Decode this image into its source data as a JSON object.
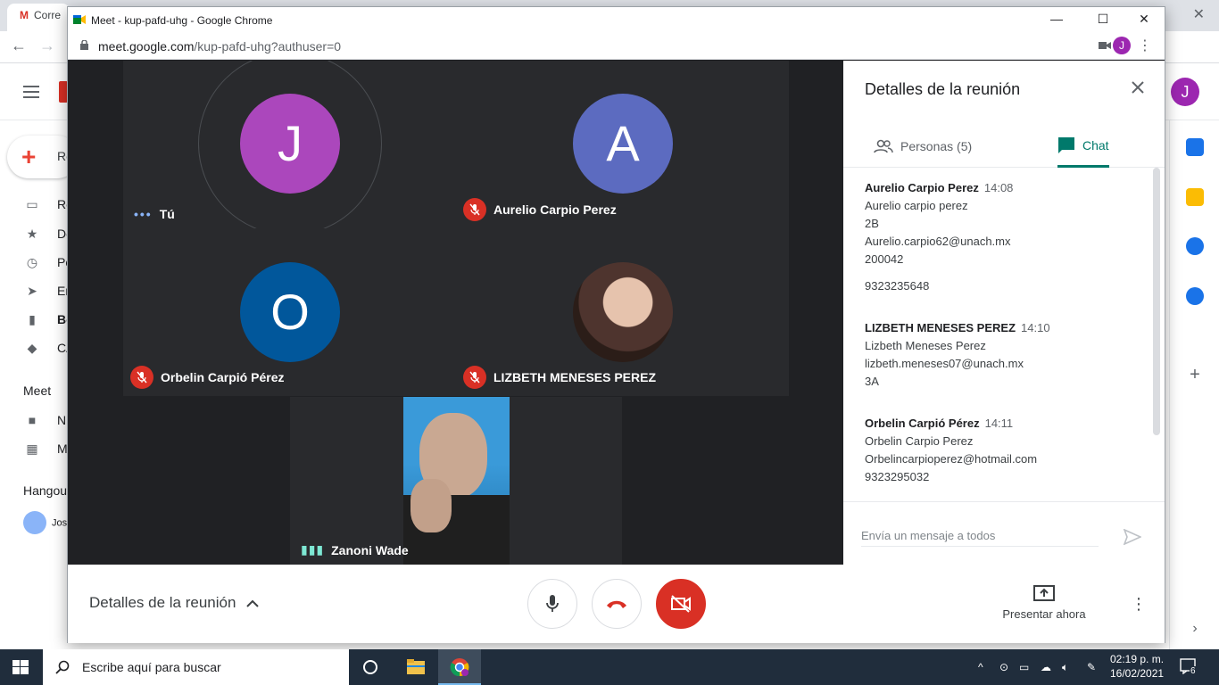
{
  "background": {
    "tab_label": "Corre",
    "compose_label": "Re",
    "nav_items": [
      "Re",
      "De",
      "Po",
      "En",
      "Bo",
      "CA"
    ],
    "meet_section": "Meet",
    "meet_items": [
      "N",
      "M"
    ],
    "hangouts_section": "Hangou",
    "hangouts_contact": "Jos",
    "avatar_letter": "J"
  },
  "window": {
    "title": "Meet - kup-pafd-uhg - Google Chrome",
    "url_host": "meet.google.com",
    "url_path": "/kup-pafd-uhg?authuser=0",
    "profile_letter": "J"
  },
  "participants": [
    {
      "initial": "J",
      "name": "Tú",
      "color": "#ab47bc",
      "muted": false
    },
    {
      "initial": "A",
      "name": "Aurelio Carpio Perez",
      "color": "#5c6bc0",
      "muted": true
    },
    {
      "initial": "O",
      "name": "Orbelin Carpió Pérez",
      "color": "#01579b",
      "muted": true
    },
    {
      "initial": "",
      "name": "LIZBETH MENESES PEREZ",
      "color": "#8d6e63",
      "muted": true
    },
    {
      "initial": "",
      "name": "Zanoni Wade",
      "color": "#1e88e5",
      "muted": false
    }
  ],
  "panel": {
    "title": "Detalles de la reunión",
    "people_tab": "Personas (5)",
    "chat_tab": "Chat",
    "compose_placeholder": "Envía un mensaje a todos",
    "messages": [
      {
        "sender": "Aurelio Carpio Perez",
        "time": "14:08",
        "lines": [
          "Aurelio carpio perez",
          "2B",
          "Aurelio.carpio62@unach.mx",
          "200042",
          "",
          "9323235648"
        ]
      },
      {
        "sender": "LIZBETH MENESES PEREZ",
        "time": "14:10",
        "lines": [
          "Lizbeth Meneses Perez",
          "lizbeth.meneses07@unach.mx",
          "3A"
        ]
      },
      {
        "sender": "Orbelin Carpió Pérez",
        "time": "14:11",
        "lines": [
          "Orbelin Carpio Perez",
          "Orbelincarpioperez@hotmail.com",
          "9323295032"
        ]
      }
    ]
  },
  "controls": {
    "meeting_details": "Detalles de la reunión",
    "present_now": "Presentar ahora"
  },
  "taskbar": {
    "search_placeholder": "Escribe aquí para buscar",
    "time": "02:19 p. m.",
    "date": "16/02/2021",
    "notification_count": "6"
  },
  "colors": {
    "accent_teal": "#00796b",
    "hangup_red": "#d93025",
    "taskbar": "#202d3c"
  }
}
